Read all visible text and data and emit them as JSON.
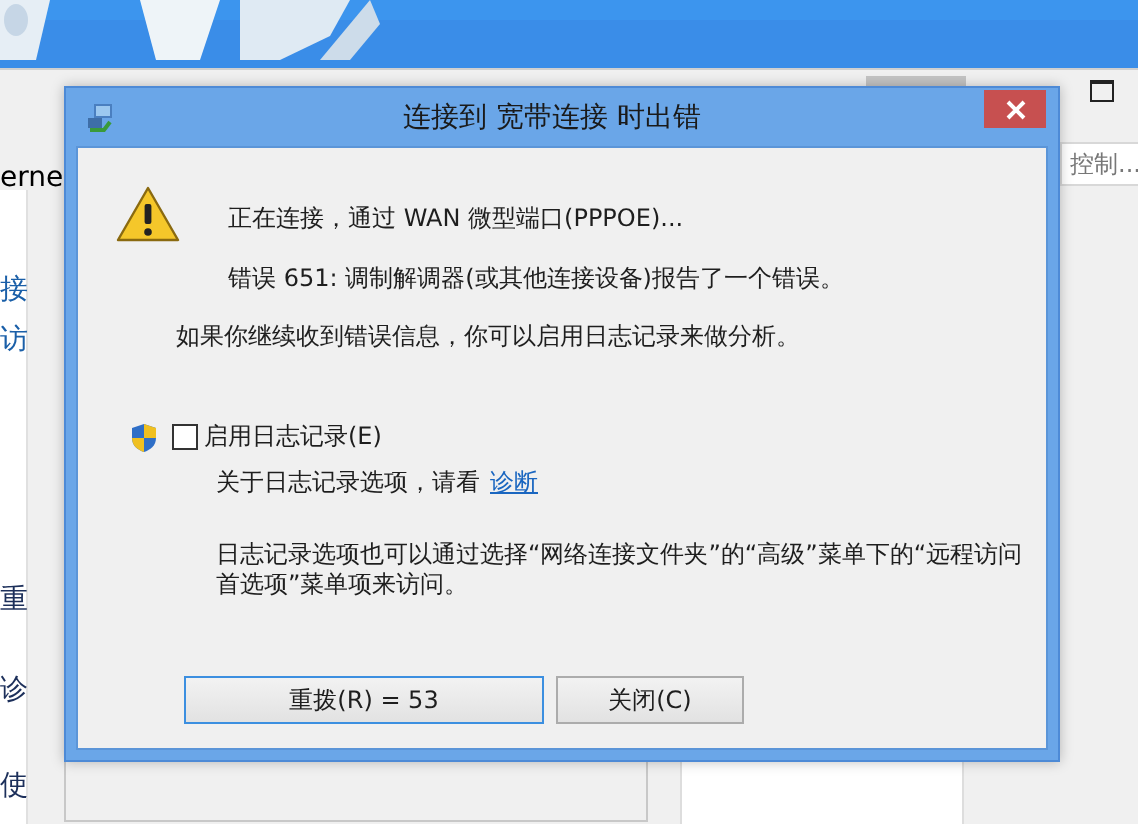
{
  "background_window": {
    "left_texts": [
      {
        "text": "erne",
        "kind": "plain"
      },
      {
        "text": "接",
        "kind": "link"
      },
      {
        "text": "访",
        "kind": "link"
      },
      {
        "text": "重",
        "kind": "heading"
      },
      {
        "text": "诊",
        "kind": "heading"
      },
      {
        "text": "使",
        "kind": "heading"
      }
    ],
    "search_text": "控制..."
  },
  "dialog": {
    "title": "连接到 宽带连接 时出错",
    "status": "正在连接，通过 WAN 微型端口(PPPOE)...",
    "error": "错误 651: 调制解调器(或其他连接设备)报告了一个错误。",
    "advice": "如果你继续收到错误信息，你可以启用日志记录来做分析。",
    "logging_checkbox": {
      "label": "启用日志记录(E)",
      "checked": false
    },
    "help_text": "关于日志记录选项，请看",
    "help_link": "诊断",
    "note": "日志记录选项也可以通过选择“网络连接文件夹”的“高级”菜单下的“远程访问首选项”菜单项来访问。",
    "buttons": [
      {
        "label": "重拨(R) = 53",
        "default": true
      },
      {
        "label": "关闭(C)",
        "default": false
      }
    ]
  }
}
